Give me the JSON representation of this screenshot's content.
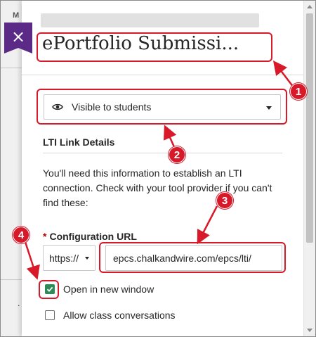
{
  "background": {
    "column_header_letter": "M"
  },
  "panel": {
    "close_label": "×",
    "title": "ePortfolio Submissi...",
    "visibility": {
      "icon": "eye-icon",
      "selected": "Visible to students"
    },
    "lti": {
      "heading": "LTI Link Details",
      "info": "You'll need this information to establish an LTI connection. Check with your tool provider if you can't find these:",
      "config": {
        "required_mark": "*",
        "label": "Configuration URL",
        "protocol": "https://",
        "url": "epcs.chalkandwire.com/epcs/lti/"
      },
      "options": [
        {
          "label": "Open in new window",
          "checked": true
        },
        {
          "label": "Allow class conversations",
          "checked": false
        }
      ]
    }
  },
  "annotations": {
    "color": "#d7192a",
    "callouts": [
      "1",
      "2",
      "3",
      "4"
    ]
  },
  "colors": {
    "accent_purple": "#5b2a86",
    "checkbox_green": "#2f8a57"
  }
}
